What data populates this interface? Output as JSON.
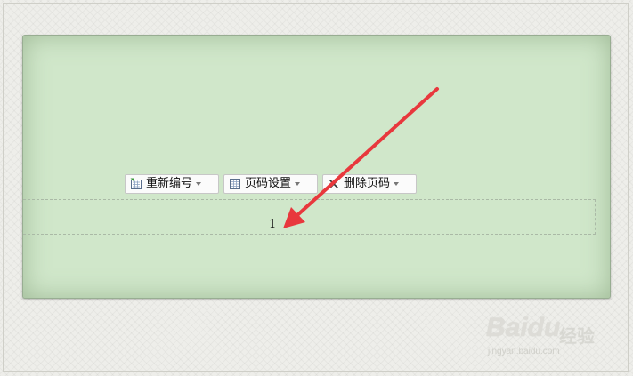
{
  "toolbar": {
    "renumber": {
      "label": "重新编号",
      "icon": "renumber-icon"
    },
    "page_number_settings": {
      "label": "页码设置",
      "icon": "page-settings-icon"
    },
    "delete_page_number": {
      "label": "删除页码",
      "icon": "delete-icon"
    }
  },
  "footer": {
    "page_number": "1"
  },
  "annotation": {
    "arrow_color": "#e8383d"
  },
  "watermark": {
    "brand": "Baidu",
    "brand_cn": "经验",
    "url": "jingyan.baidu.com"
  },
  "colors": {
    "page_background": "#d0e7ca",
    "canvas_background": "#eeeeea"
  }
}
